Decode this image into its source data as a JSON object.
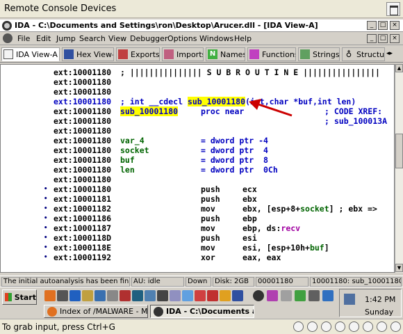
{
  "remote_console": {
    "menu": [
      {
        "label": "Remote Console"
      },
      {
        "label": "Devices"
      }
    ]
  },
  "ida": {
    "title": "IDA - C:\\Documents and Settings\\ron\\Desktop\\Arucer.dll - [IDA View-A]",
    "menu": [
      "File",
      "Edit",
      "Jump",
      "Search",
      "View",
      "Debugger",
      "Options",
      "Windows",
      "Help"
    ],
    "tabs": [
      {
        "label": "IDA View-A",
        "icon": "disassembly-icon",
        "active": true
      },
      {
        "label": "Hex View-A",
        "icon": "hex-icon"
      },
      {
        "label": "Exports",
        "icon": "exports-icon"
      },
      {
        "label": "Imports",
        "icon": "imports-icon"
      },
      {
        "label": "Names",
        "icon": "names-icon"
      },
      {
        "label": "Functions",
        "icon": "functions-icon"
      },
      {
        "label": "Strings",
        "icon": "strings-icon"
      },
      {
        "label": "Structu",
        "icon": "structures-icon"
      }
    ],
    "disasm": [
      {
        "addr": "ext:10001180",
        "code": "; ||||||||||||||| S U B R O U T I N E ||||||||||||||||",
        "style": "sub"
      },
      {
        "addr": "ext:10001180",
        "code": ""
      },
      {
        "addr": "ext:10001180",
        "code": ""
      },
      {
        "addr": "ext:10001180",
        "pre": "; int __cdecl ",
        "func": "sub_10001180",
        "post": "(int,char *buf,int len)",
        "style": "proto"
      },
      {
        "addr": "ext:10001180",
        "name": "sub_10001180",
        "code": "proc near",
        "xref": "; CODE XREF:",
        "style": "procdef"
      },
      {
        "addr": "ext:10001180",
        "xref": "; sub_100013A",
        "style": "xref2"
      },
      {
        "addr": "ext:10001180",
        "code": ""
      },
      {
        "addr": "ext:10001180",
        "var": "var_4",
        "eq": "= dword ptr -4",
        "style": "var"
      },
      {
        "addr": "ext:10001180",
        "var": "socket",
        "eq": "= dword ptr  4",
        "style": "var"
      },
      {
        "addr": "ext:10001180",
        "var": "buf",
        "eq": "= dword ptr  8",
        "style": "var"
      },
      {
        "addr": "ext:10001180",
        "var": "len",
        "eq": "= dword ptr  0Ch",
        "style": "var"
      },
      {
        "addr": "ext:10001180",
        "code": ""
      },
      {
        "addr": "ext:10001180",
        "mn": "push",
        "op": "ecx",
        "bullet": true
      },
      {
        "addr": "ext:10001181",
        "mn": "push",
        "op": "ebx",
        "bullet": true
      },
      {
        "addr": "ext:10001182",
        "mn": "mov",
        "op_pre": "ebx, [esp+8+",
        "op_var": "socket",
        "op_post": "] ; ebx =>",
        "bullet": true
      },
      {
        "addr": "ext:10001186",
        "mn": "push",
        "op": "ebp",
        "bullet": true
      },
      {
        "addr": "ext:10001187",
        "mn": "mov",
        "op_pre": "ebp, ds:",
        "op_mag": "recv",
        "bullet": true
      },
      {
        "addr": "ext:1000118D",
        "mn": "push",
        "op": "esi",
        "bullet": true
      },
      {
        "addr": "ext:1000118E",
        "mn": "mov",
        "op_pre": "esi, [esp+10h+",
        "op_var": "buf",
        "op_post": "]",
        "bullet": true
      },
      {
        "addr": "ext:10001192",
        "mn": "xor",
        "op": "eax, eax",
        "bullet": true
      }
    ],
    "status": {
      "message": "The initial autoanalysis has been finished.",
      "au": "AU:  idle",
      "direction": "Down",
      "disk": "Disk: 2GB",
      "offset": "00001180",
      "location": "10001180: sub_10001180"
    }
  },
  "taskbar": {
    "start": "Start",
    "buttons": [
      {
        "label": "Index of /MALWARE - M..."
      },
      {
        "label": "IDA - C:\\Documents a..."
      }
    ],
    "clock": "1:42 PM",
    "day": "Sunday"
  },
  "console_status": "To grab input, press Ctrl+G",
  "colors": {
    "highlight": "#ffff00",
    "address_blue": "#0000c0",
    "variable_green": "#006400",
    "import_magenta": "#a000a0",
    "arrow_red": "#cc0000"
  }
}
